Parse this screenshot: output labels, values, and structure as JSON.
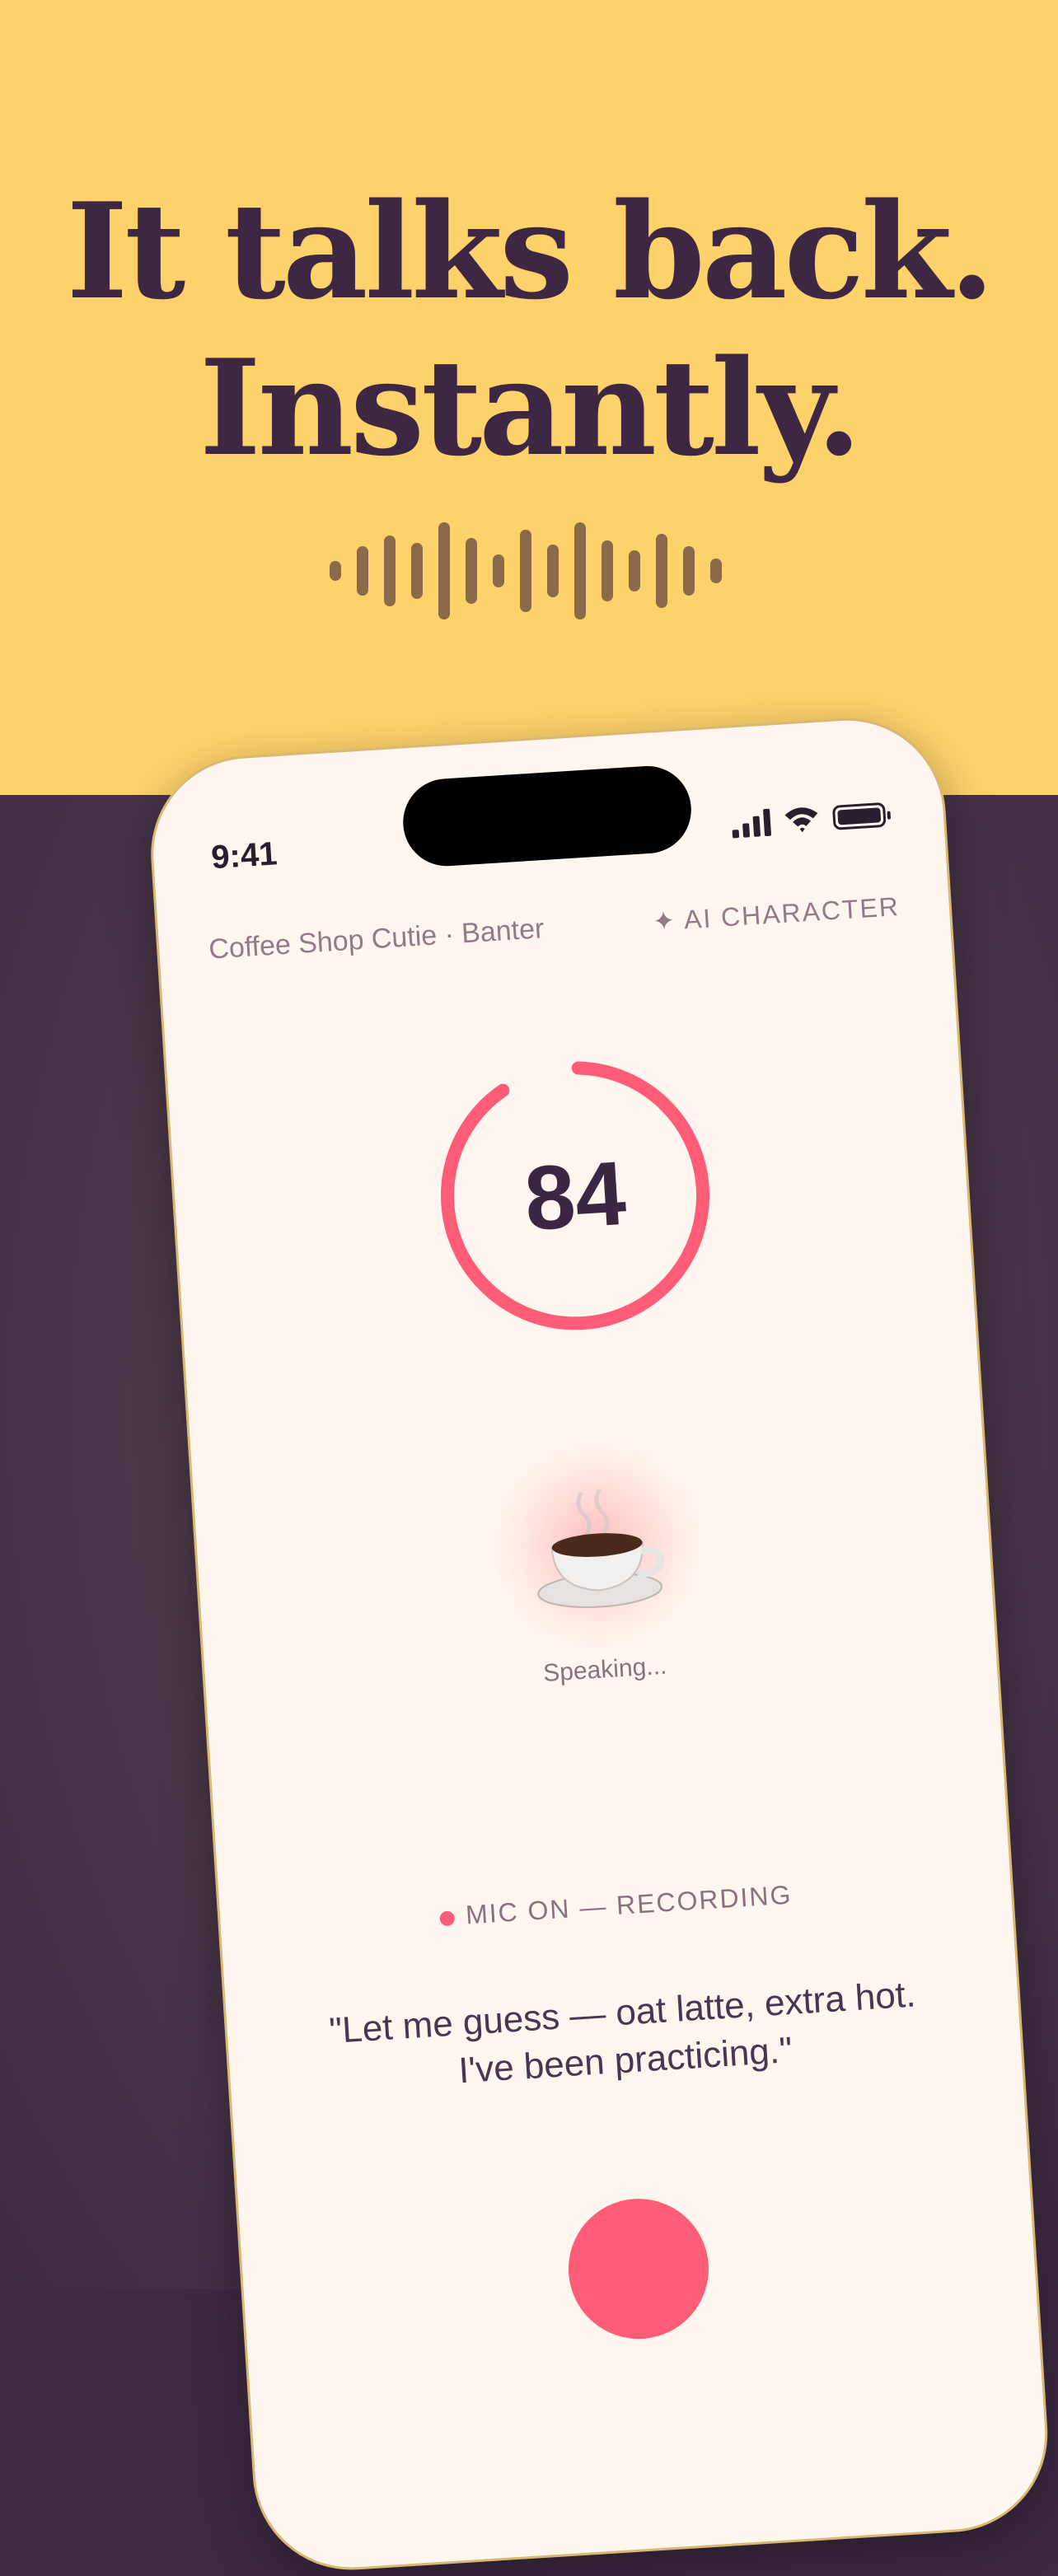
{
  "headline": {
    "line1": "It talks back.",
    "line2": "Instantly."
  },
  "status_bar": {
    "time": "9:41"
  },
  "character": {
    "title": "Coffee Shop Cutie · Banter",
    "badge": "✦ AI CHARACTER"
  },
  "score": {
    "value": "84",
    "ring_progress": 0.9
  },
  "avatar": {
    "emoji": "☕",
    "status": "Speaking..."
  },
  "mic": {
    "status": "MIC ON — RECORDING"
  },
  "quote": {
    "text": "\"Let me guess — oat latte, extra hot. I've been practicing.\""
  },
  "colors": {
    "top_bg": "#fed26b",
    "bottom_bg": "#3f2a45",
    "accent": "#ff5c78",
    "ink": "#3d2743"
  }
}
